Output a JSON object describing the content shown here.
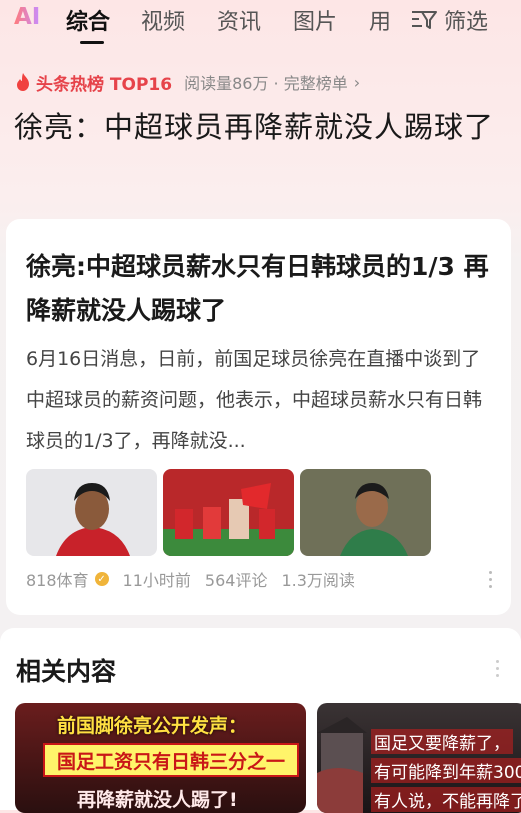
{
  "tabs": {
    "ai": "AI",
    "items": [
      "综合",
      "视频",
      "资讯",
      "图片",
      "用"
    ],
    "filter": "筛选"
  },
  "hot": {
    "title": "头条热榜 TOP16",
    "meta": "阅读量86万 · 完整榜单",
    "arrow": "›"
  },
  "headline": "徐亮：中超球员再降薪就没人踢球了",
  "card": {
    "title": "徐亮:中超球员薪水只有日韩球员的1/3 再降薪就没人踢球了",
    "summary": "6月16日消息，日前，前国足球员徐亮在直播中谈到了中超球员的薪资问题，他表示，中超球员薪水只有日韩球员的1/3了，再降就没...",
    "source": "818体育",
    "time": "11小时前",
    "comments": "564评论",
    "reads": "1.3万阅读"
  },
  "related": {
    "title": "相关内容",
    "card1": {
      "line1": "前国脚徐亮公开发声：",
      "line2": "国足工资只有日韩三分之一",
      "line3": "再降薪就没人踢了!"
    },
    "card2": {
      "line1": "国足又要降薪了，",
      "line2": "有可能降到年薪300",
      "line3": "有人说，不能再降了"
    }
  }
}
